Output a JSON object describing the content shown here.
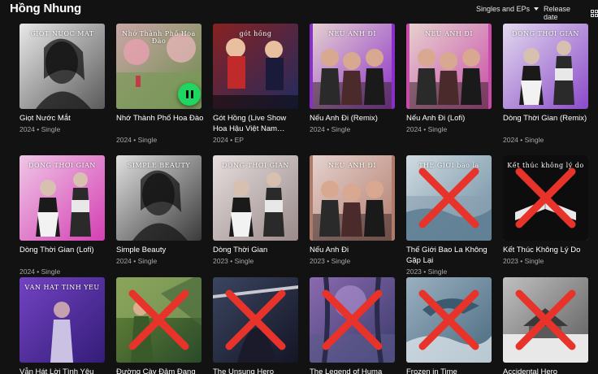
{
  "header": {
    "artist_name": "Hồng Nhung",
    "filter_label": "Singles and EPs",
    "sort_label": "Release date"
  },
  "albums": [
    {
      "title": "Giọt Nước Mắt",
      "meta": "2024 • Single",
      "cover_text": "GIOT NUOC MAT",
      "colors": [
        "#e8e8e8",
        "#5a5a5a"
      ],
      "cover_icon": "portrait-bw",
      "unavailable": false
    },
    {
      "title": "Nhớ Thành Phố Hoa Đào",
      "meta": "2024 • Single",
      "cover_text": "Nhớ Thành Phố Hoa Đào",
      "colors": [
        "#c9a7a6",
        "#6b8a4a"
      ],
      "cover_icon": "blossom-landscape",
      "unavailable": false,
      "playing": true
    },
    {
      "title": "Gót Hồng (Live Show Hoa Hậu Việt Nam…",
      "meta": "2024 • EP",
      "cover_text": "gót hồng",
      "colors": [
        "#c82b2b",
        "#2a3a8a"
      ],
      "cover_icon": "live-show",
      "unavailable": false
    },
    {
      "title": "Nếu Anh Đi (Remix)",
      "meta": "2024 • Single",
      "cover_text": "NẾU ANH ĐI",
      "colors": [
        "#e6d3cf",
        "#8a2dc9"
      ],
      "cover_icon": "trio-women",
      "unavailable": false
    },
    {
      "title": "Nếu Anh Đi (Lofi)",
      "meta": "2024 • Single",
      "cover_text": "NẾU ANH ĐI",
      "colors": [
        "#e6d3cf",
        "#c94aa8"
      ],
      "cover_icon": "trio-women",
      "unavailable": false
    },
    {
      "title": "Dòng Thời Gian (Remix)",
      "meta": "2024 • Single",
      "cover_text": "DÒNG THỜI GIAN",
      "colors": [
        "#e2d9ee",
        "#8a4ac9"
      ],
      "cover_icon": "duo-fashion",
      "unavailable": false
    },
    {
      "title": "Dòng Thời Gian (Lofi)",
      "meta": "2024 • Single",
      "cover_text": "DÒNG THỜI GIAN",
      "colors": [
        "#efc6e6",
        "#d43fb3"
      ],
      "cover_icon": "duo-fashion",
      "unavailable": false
    },
    {
      "title": "Simple Beauty",
      "meta": "2024 • Single",
      "cover_text": "SIMPLE BEAUTY",
      "colors": [
        "#e0e0e0",
        "#3a3a3a"
      ],
      "cover_icon": "portrait-bw",
      "unavailable": false
    },
    {
      "title": "Dòng Thời Gian",
      "meta": "2023 • Single",
      "cover_text": "DÒNG THỜI GIAN",
      "colors": [
        "#e6dede",
        "#9a8a8a"
      ],
      "cover_icon": "duo-fashion",
      "unavailable": false
    },
    {
      "title": "Nếu Anh Đi",
      "meta": "2023 • Single",
      "cover_text": "NẾU ANH ĐI",
      "colors": [
        "#e6d3cf",
        "#b07a6a"
      ],
      "cover_icon": "trio-women",
      "unavailable": false
    },
    {
      "title": "Thế Giới Bao La Không Gặp Lại",
      "meta": "2023 • Single",
      "cover_text": "THẾ GIỚI bao la",
      "colors": [
        "#d0dbe0",
        "#6a8aa0"
      ],
      "cover_icon": "misty-sea",
      "unavailable": true
    },
    {
      "title": "Kết Thúc Không Lý Do",
      "meta": "2023 • Single",
      "cover_text": "Kết thúc không lý do",
      "colors": [
        "#1a1a1a",
        "#e8e8e8"
      ],
      "cover_icon": "book-dark",
      "unavailable": true
    },
    {
      "title": "Vẫn Hát Lời Tình Yêu",
      "meta": "",
      "cover_text": "VẪN HÁT TÌNH YÊU",
      "colors": [
        "#7a4ac9",
        "#2a1a6a"
      ],
      "cover_icon": "singer-stage",
      "unavailable": false
    },
    {
      "title": "Đường Cày Đảm Đang",
      "meta": "",
      "cover_text": "",
      "colors": [
        "#6a8a3a",
        "#2a4a2a"
      ],
      "cover_icon": "field-woman",
      "unavailable": true
    },
    {
      "title": "The Unsung Hero",
      "meta": "",
      "cover_text": "",
      "colors": [
        "#5a6a8a",
        "#1a1a2a"
      ],
      "cover_icon": "dark-warrior",
      "unavailable": true
    },
    {
      "title": "The Legend of Huma",
      "meta": "",
      "cover_text": "",
      "colors": [
        "#8a6ab0",
        "#3a3a6a"
      ],
      "cover_icon": "purple-forest",
      "unavailable": true
    },
    {
      "title": "Frozen in Time",
      "meta": "",
      "cover_text": "",
      "colors": [
        "#9ab0c0",
        "#4a6a80"
      ],
      "cover_icon": "ice-dragon",
      "unavailable": true
    },
    {
      "title": "Accidental Hero",
      "meta": "",
      "cover_text": "",
      "colors": [
        "#c0c0c0",
        "#5a5a5a"
      ],
      "cover_icon": "snow-temple",
      "unavailable": true
    }
  ],
  "colors": {
    "background": "#121212",
    "play_button": "#1ed760",
    "unavailable_x": "#e8332a",
    "meta_text": "#a7a7a7"
  }
}
